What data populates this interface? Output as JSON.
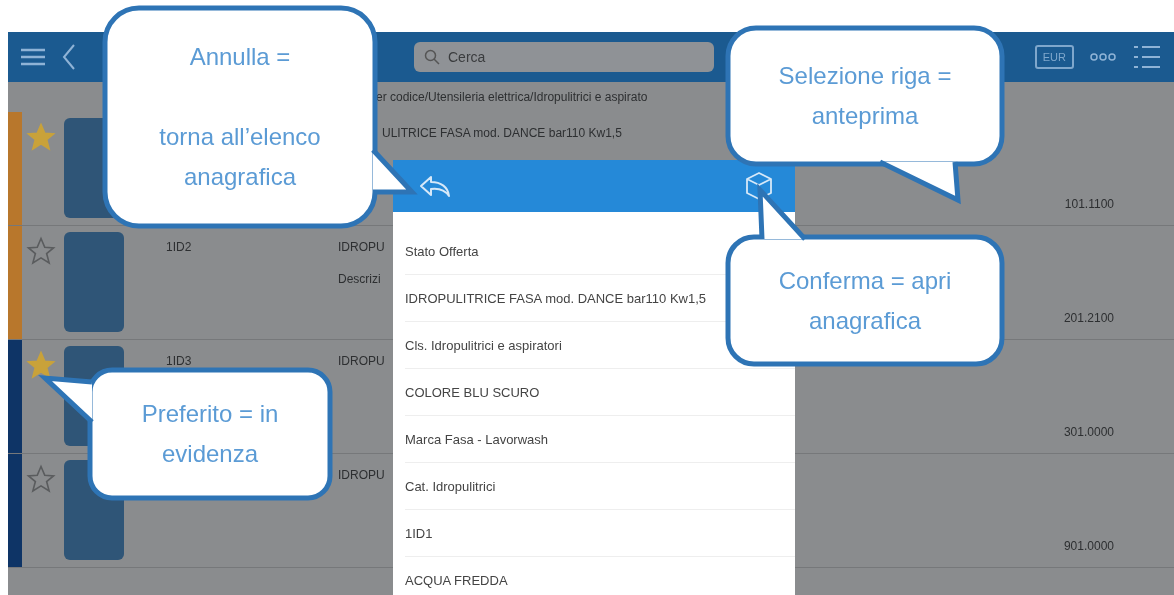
{
  "toolbar": {
    "search": {
      "placeholder": "Cerca"
    },
    "currency": "EUR"
  },
  "breadcrumb": "er codice/Utensileria elettrica/Idropulitrici e aspirato",
  "rows": [
    {
      "color": "#b8772c",
      "favorite": true,
      "description": "ULITRICE FASA mod. DANCE bar110 Kw1,5",
      "price": "101.1100"
    },
    {
      "color": "#b8772c",
      "favorite": false,
      "code": "1ID2",
      "description": "IDROPU",
      "note": "Descrizi",
      "price": "201.2100"
    },
    {
      "color": "#0e3466",
      "favorite": true,
      "code": "1ID3",
      "description": "IDROPU",
      "price": "301.0000"
    },
    {
      "color": "#0e3466",
      "favorite": false,
      "description": "IDROPU",
      "price": "901.0000"
    }
  ],
  "preview": {
    "items": [
      "Stato Offerta",
      "IDROPULITRICE FASA mod. DANCE bar110 Kw1,5",
      "Cls. Idropulitrici e aspiratori",
      "COLORE BLU SCURO",
      "Marca Fasa - Lavorwash",
      "Cat. Idropulitrici",
      "1ID1",
      "ACQUA FREDDA"
    ]
  },
  "callouts": [
    {
      "lines": [
        "Annulla =",
        "torna all’elenco anagrafica"
      ]
    },
    {
      "lines": [
        "Selezione riga = anteprima"
      ]
    },
    {
      "lines": [
        "Conferma = apri anagrafica"
      ]
    },
    {
      "lines": [
        "Preferito = in evidenza"
      ]
    }
  ]
}
